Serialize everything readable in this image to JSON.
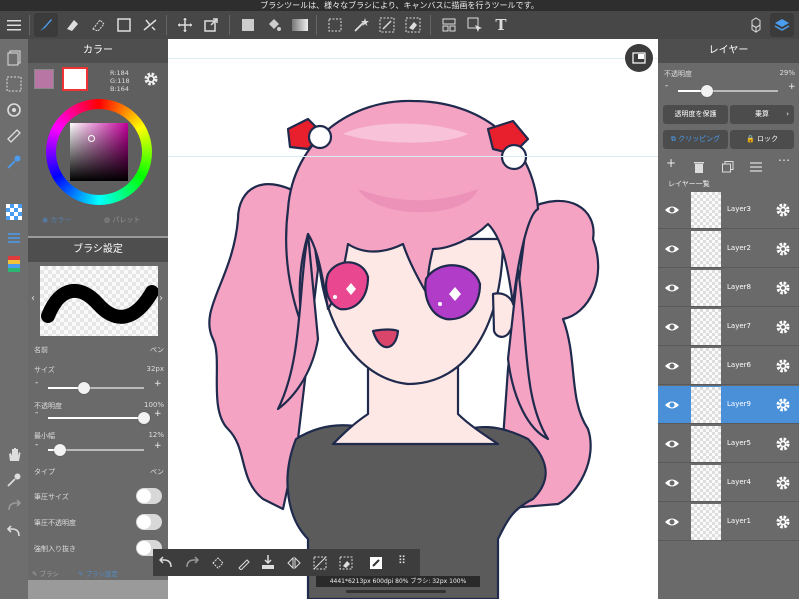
{
  "status": {
    "tooltip": "ブラシツールは、様々なブラシにより、キャンバスに描画を行うツールです。"
  },
  "toolbar": {
    "tools": [
      "menu-icon",
      "brush-icon",
      "eraser-icon",
      "fill-eraser-icon",
      "rect-icon",
      "snap-icon",
      "move-icon",
      "transform-icon",
      "fill-rect-icon",
      "bucket-icon",
      "gradient-icon",
      "select-rect-icon",
      "magic-wand-icon",
      "select-pen-icon",
      "select-eraser-icon",
      "divide-icon",
      "hand-select-icon",
      "text-icon",
      "materials-icon",
      "layers-icon"
    ]
  },
  "colorPanel": {
    "title": "カラー",
    "rgb": {
      "r": "R:184",
      "g": "G:118",
      "b": "B:164"
    },
    "tab_color": "カラー",
    "tab_palette": "パレット",
    "current_color": "#b876a4"
  },
  "brushPanel": {
    "title": "ブラシ設定",
    "name_label": "名前",
    "name_value": "ペン",
    "size_label": "サイズ",
    "size_value": "32px",
    "size_level": 0.38,
    "opacity_label": "不透明度",
    "opacity_value": "100%",
    "opacity_level": 1.0,
    "minwidth_label": "最小幅",
    "minwidth_value": "12%",
    "minwidth_level": 0.12,
    "type_label": "タイプ",
    "type_value": "ペン",
    "pressure_size": "筆圧サイズ",
    "pressure_opacity": "筆圧不透明度",
    "force_start_end": "強制入り抜き",
    "bottom_brush": "ブラシ",
    "bottom_brush_settings": "ブラシ設定"
  },
  "layerPanel": {
    "title": "レイヤー",
    "opacity_label": "不透明度",
    "opacity_value": "29%",
    "opacity_level": 0.29,
    "protect_alpha": "透明度を保護",
    "blend_mode": "乗算",
    "clipping": "クリッピング",
    "lock": "ロック",
    "list_title": "レイヤー一覧",
    "layers": [
      {
        "name": "Layer3"
      },
      {
        "name": "Layer2"
      },
      {
        "name": "Layer8"
      },
      {
        "name": "Layer7"
      },
      {
        "name": "Layer6"
      },
      {
        "name": "Layer9",
        "selected": true
      },
      {
        "name": "Layer5"
      },
      {
        "name": "Layer4"
      },
      {
        "name": "Layer1"
      }
    ]
  },
  "canvasStatus": "4441*6213px 600dpi 80% ブラシ: 32px 100%",
  "colors": {
    "hair": "#f4a3c3",
    "hair_dark": "#e37fab",
    "outline": "#1f2a4d",
    "skin": "#fde8e6",
    "top": "#5b5b5b",
    "bow": "#e8202e",
    "selected_layer": "#4a90d9"
  }
}
